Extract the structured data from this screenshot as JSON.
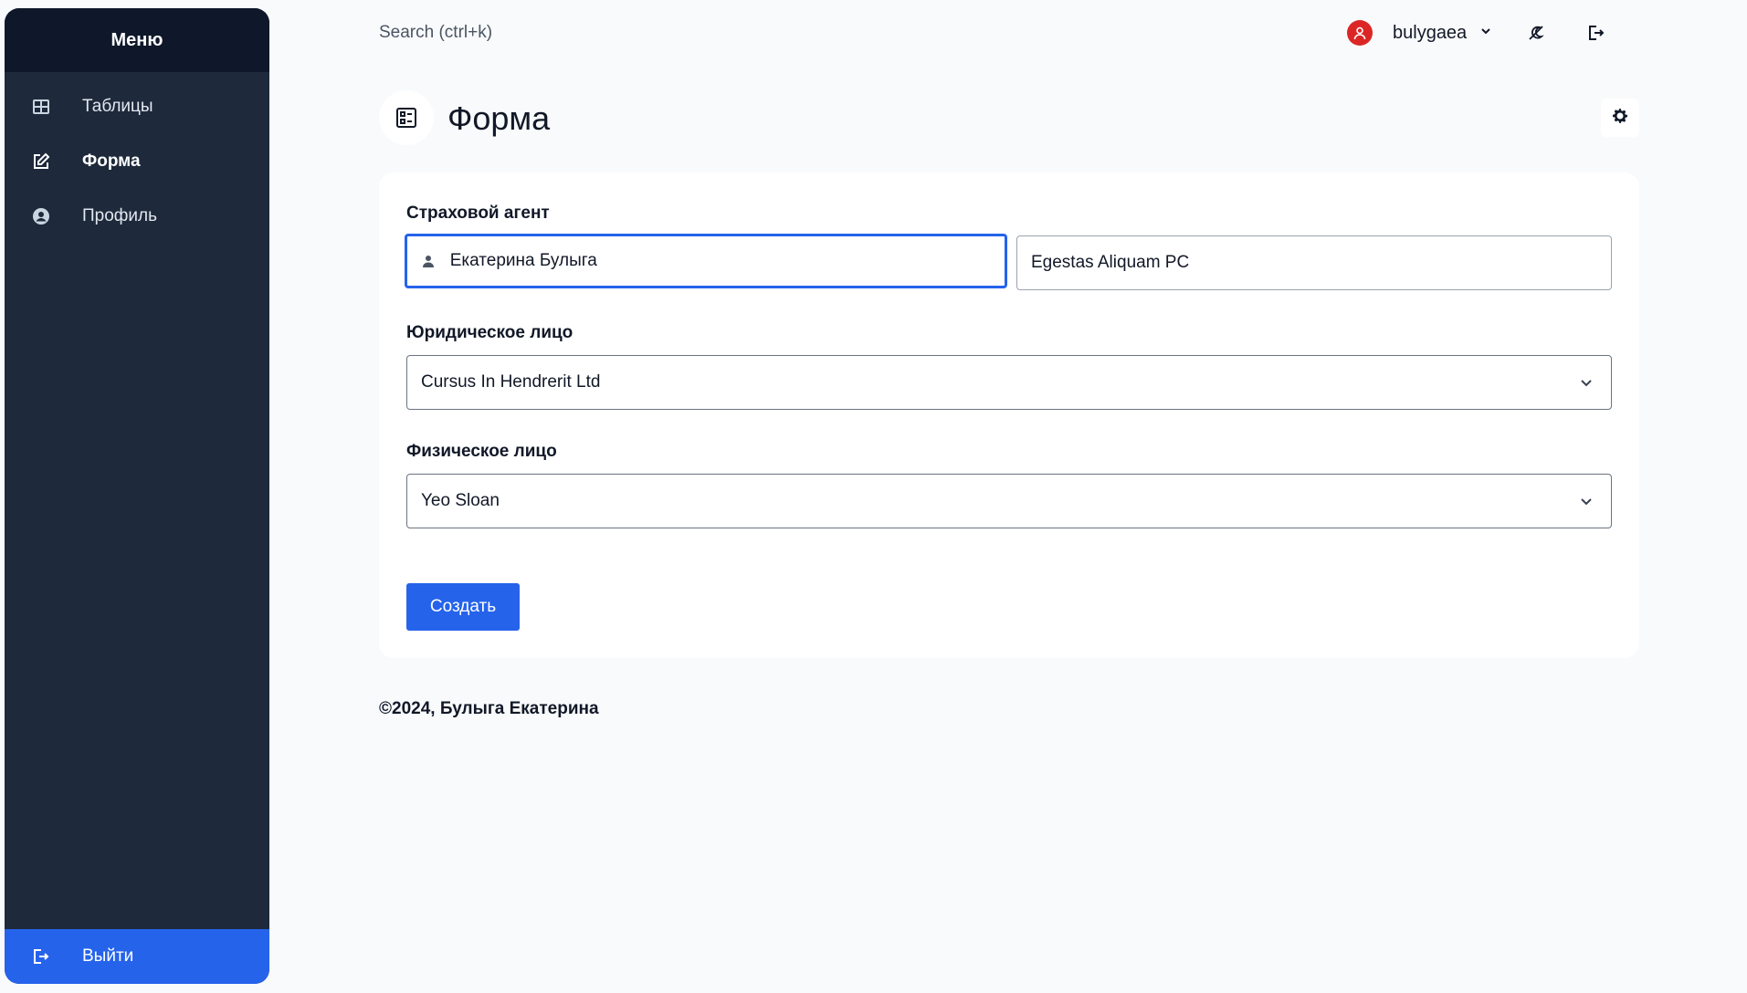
{
  "sidebar": {
    "title": "Меню",
    "items": [
      {
        "label": "Таблицы",
        "icon": "table-icon"
      },
      {
        "label": "Форма",
        "icon": "edit-icon"
      },
      {
        "label": "Профиль",
        "icon": "user-circle-icon"
      }
    ],
    "logout_label": "Выйти"
  },
  "topbar": {
    "search_placeholder": "Search (ctrl+k)",
    "username": "bulygaea"
  },
  "page": {
    "title": "Форма"
  },
  "form": {
    "agent_label": "Страховой агент",
    "agent_name": "Екатерина Булыга",
    "agent_company": "Egestas Aliquam PC",
    "legal_label": "Юридическое лицо",
    "legal_value": "Cursus In Hendrerit Ltd",
    "person_label": "Физическое лицо",
    "person_value": "Yeo Sloan",
    "submit_label": "Создать"
  },
  "footer": {
    "copyright": "©2024, Булыга Екатерина"
  },
  "colors": {
    "sidebar_bg": "#1e293b",
    "sidebar_header_bg": "#0f172a",
    "accent": "#2563eb",
    "avatar": "#dc2626",
    "page_bg": "#f9fafb"
  }
}
